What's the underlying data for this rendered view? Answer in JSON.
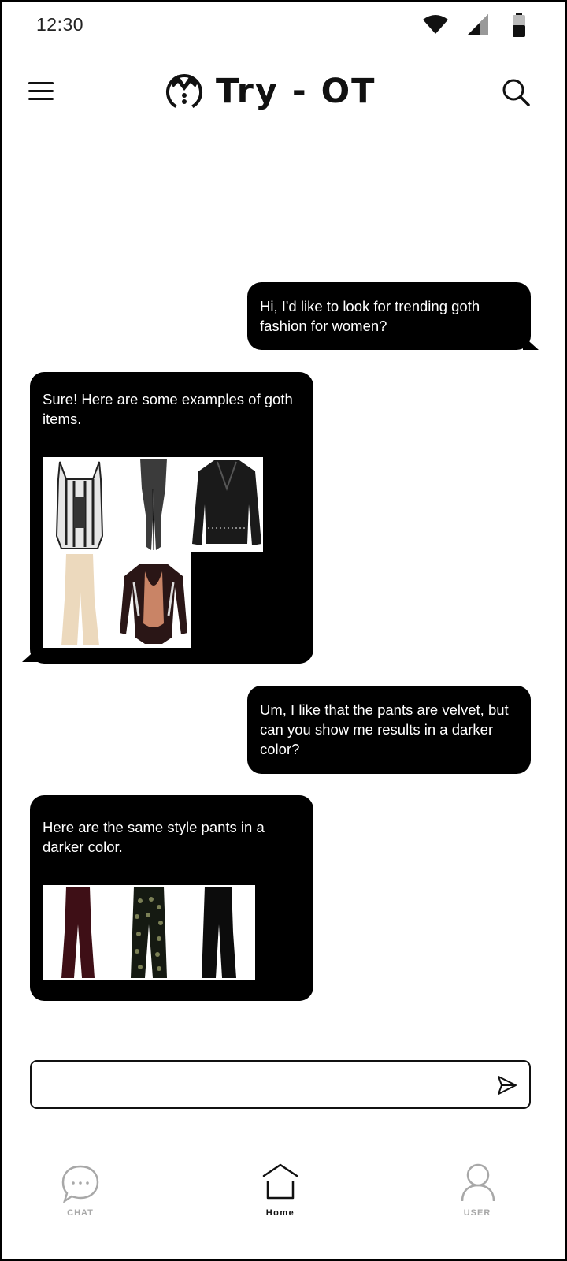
{
  "status_bar": {
    "time": "12:30"
  },
  "header": {
    "logo_text": "Try - OT"
  },
  "messages": [
    {
      "sender": "user",
      "text": "Hi, I'd like to look for trending goth fashion for women?"
    },
    {
      "sender": "bot",
      "text": "Sure! Here are some examples of goth items.",
      "items": [
        "corset-top",
        "sheer-tights",
        "studded-leather-jacket",
        "velvet-flared-pants",
        "printed-bodysuit"
      ]
    },
    {
      "sender": "user",
      "text": "Um, I like that the pants are velvet, but can you show me results in a darker color?"
    },
    {
      "sender": "bot",
      "text": "Here are the same style pants in a darker color.",
      "items": [
        "burgundy-flared-pants",
        "polka-dot-velvet-pants",
        "black-velvet-pants"
      ]
    }
  ],
  "composer": {
    "value": "",
    "placeholder": ""
  },
  "nav": {
    "items": [
      {
        "label": "CHAT",
        "icon": "chat-bubble-icon",
        "color": "#a8a8a8"
      },
      {
        "label": "Home",
        "icon": "home-icon",
        "color": "#111111",
        "active": true
      },
      {
        "label": "USER",
        "icon": "user-icon",
        "color": "#a8a8a8"
      }
    ]
  },
  "colors": {
    "bubble": "#000000",
    "text_on_bubble": "#ffffff",
    "inactive_nav": "#a8a8a8"
  }
}
